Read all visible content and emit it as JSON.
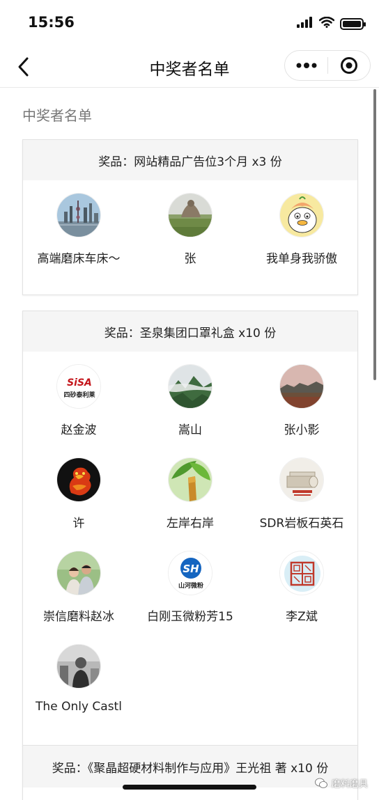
{
  "status_bar": {
    "time": "15:56"
  },
  "nav": {
    "title": "中奖者名单"
  },
  "page": {
    "section_title": "中奖者名单"
  },
  "prizes": [
    {
      "label": "奖品：网站精品广告位3个月 x3 份",
      "winners": [
        {
          "name": "高端磨床车床～",
          "avatar": "city-skyline-avatar"
        },
        {
          "name": "张",
          "avatar": "monument-statue-avatar"
        },
        {
          "name": "我单身我骄傲",
          "avatar": "cartoon-duck-avatar"
        }
      ]
    },
    {
      "label": "奖品：圣泉集团口罩礼盒 x10 份",
      "winners": [
        {
          "name": "赵金波",
          "avatar": "sisa-logo-avatar",
          "logo_top": "SiSA",
          "logo_bottom": "四砂泰利莱"
        },
        {
          "name": "嵩山",
          "avatar": "mountain-mist-avatar"
        },
        {
          "name": "张小影",
          "avatar": "sunset-field-avatar"
        },
        {
          "name": "许",
          "avatar": "red-dragon-avatar"
        },
        {
          "name": "左岸右岸",
          "avatar": "green-leaf-avatar"
        },
        {
          "name": "SDR岩板石英石",
          "avatar": "stone-slab-avatar"
        },
        {
          "name": "崇信磨料赵冰",
          "avatar": "couple-photo-avatar"
        },
        {
          "name": "白刚玉微粉芳15",
          "avatar": "sh-logo-avatar",
          "logo_top": "SH",
          "logo_bottom": "山河微粉"
        },
        {
          "name": "李Z斌",
          "avatar": "seal-stamp-avatar"
        },
        {
          "name": "The Only Castl",
          "avatar": "bw-portrait-avatar"
        }
      ]
    },
    {
      "label": "奖品：《聚晶超硬材料制作与应用》王光祖 著 x10 份"
    }
  ],
  "watermark": {
    "text": "磨料磨具"
  }
}
